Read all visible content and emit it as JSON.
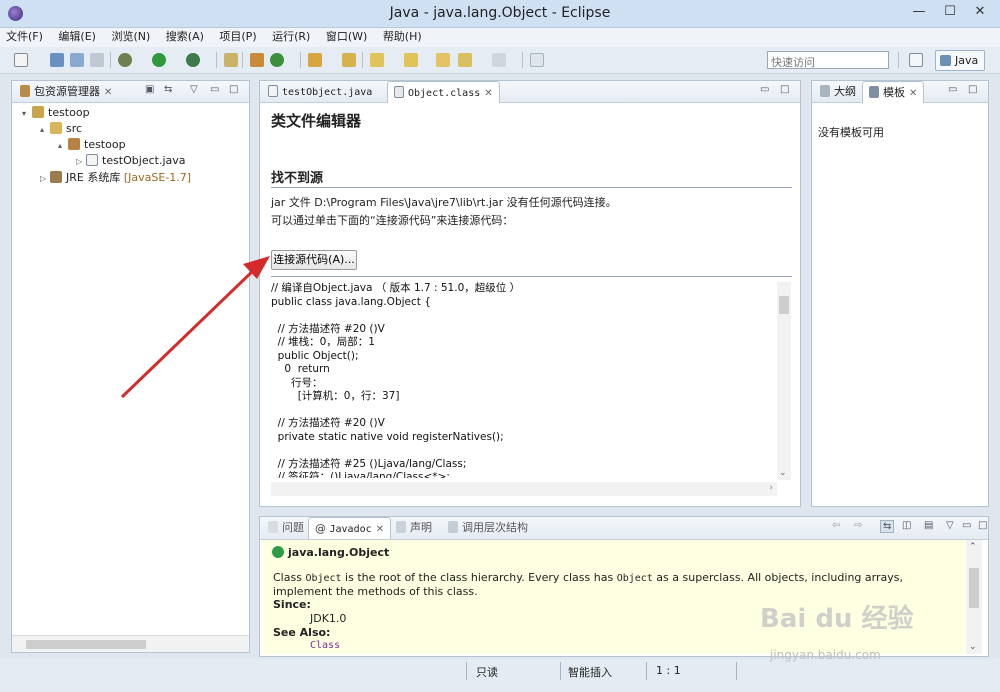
{
  "window": {
    "title": "Java  -  java.lang.Object  -  Eclipse",
    "minimize": "—",
    "maximize": "☐",
    "close": "✕"
  },
  "menu": [
    "文件(F)",
    "编辑(E)",
    "浏览(N)",
    "搜索(A)",
    "项目(P)",
    "运行(R)",
    "窗口(W)",
    "帮助(H)"
  ],
  "toolbar": {
    "quick_access_placeholder": "快速访问",
    "perspective": "Java"
  },
  "package_explorer": {
    "tab": "包资源管理器",
    "tree": [
      {
        "label": "testoop",
        "depth": 0,
        "expander": "▾",
        "icon": "project-icon"
      },
      {
        "label": "src",
        "depth": 1,
        "expander": "▴",
        "icon": "source-folder-icon"
      },
      {
        "label": "testoop",
        "depth": 2,
        "expander": "▴",
        "icon": "package-icon"
      },
      {
        "label": "testObject.java",
        "depth": 3,
        "expander": "▷",
        "icon": "java-file-icon"
      },
      {
        "label": "JRE 系统库",
        "suffix": "[JavaSE-1.7]",
        "depth": 1,
        "expander": "▷",
        "icon": "library-icon"
      }
    ]
  },
  "editor": {
    "tabs": [
      {
        "label": "testObject.java"
      },
      {
        "label": "Object.class"
      }
    ],
    "heading": "类文件编辑器",
    "subheading": "找不到源",
    "line1": "jar 文件 D:\\Program Files\\Java\\jre7\\lib\\rt.jar 没有任何源代码连接。",
    "line2": "可以通过单击下面的“连接源代码”来连接源代码：",
    "attach_button": "连接源代码(A)...",
    "code": [
      "// 编译自Object.java （ 版本 1.7 : 51.0，超级位 ）",
      "public class java.lang.Object {",
      "",
      "  // 方法描述符 #20 ()V",
      "  // 堆栈：0，局部：1",
      "  public Object();",
      "    0  return",
      "      行号：",
      "        [计算机：0，行：37]",
      "",
      "  // 方法描述符 #20 ()V",
      "  private static native void registerNatives();",
      "",
      "  // 方法描述符 #25 ()Ljava/lang/Class;",
      "  // 签征符：()Ljava/lang/Class<*>;"
    ]
  },
  "outline": {
    "tab_outline": "大纲",
    "tab_template": "模板",
    "empty": "没有模板可用"
  },
  "bottom": {
    "tabs": [
      "问题",
      "Javadoc",
      "声明",
      "调用层次结构"
    ],
    "title": "java.lang.Object",
    "desc_pre": "Class ",
    "desc_code1": "Object",
    "desc_mid": " is the root of the class hierarchy. Every class has ",
    "desc_code2": "Object",
    "desc_post": " as a superclass. All objects, including arrays, implement the methods of this class.",
    "since_label": "Since:",
    "since_value": "JDK1.0",
    "see_label": "See Also:",
    "see_value": "Class"
  },
  "status": {
    "readonly": "只读",
    "insert": "智能插入",
    "position": "1 : 1"
  },
  "watermark": {
    "logo": "Bai du 经验",
    "url": "jingyan.baidu.com"
  },
  "colors": {
    "arrow": "#d42a2a",
    "javadoc_bg": "#ffffe1",
    "link": "#7a2ba0"
  }
}
